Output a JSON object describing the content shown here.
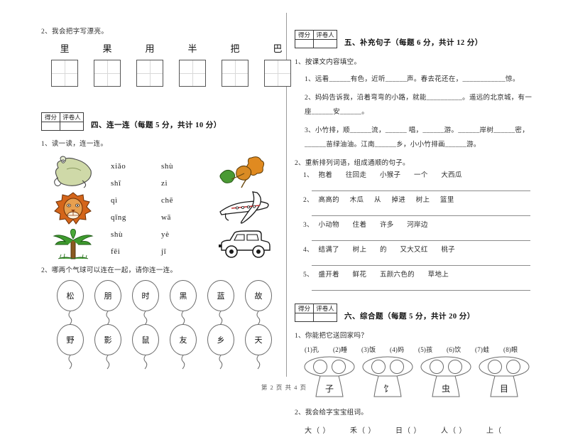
{
  "document": {
    "footer": "第 2 页 共 4 页"
  },
  "left_column": {
    "handwriting": {
      "prompt": "2、我会把字写漂亮。",
      "characters": [
        "里",
        "果",
        "用",
        "半",
        "把",
        "巴"
      ]
    },
    "section_four": {
      "score_header": {
        "score_label": "得分",
        "grader_label": "评卷人"
      },
      "title": "四、连一连（每题 5 分，共计 10 分）",
      "q1_prompt": "1、读一读，连一连。",
      "pinyin_left": [
        "xiǎo",
        "shī",
        "qì",
        "qīng",
        "shù",
        "fēi"
      ],
      "pinyin_right": [
        "shù",
        "zi",
        "chē",
        "wā",
        "yè",
        "jī"
      ],
      "pictures": [
        "frog",
        "oak-leaves",
        "lion",
        "airplane",
        "tree",
        "car"
      ],
      "q2_prompt": "2、哪两个气球可以连在一起，请你连一连。",
      "balloons_row1": [
        "松",
        "朋",
        "时",
        "黑",
        "蓝",
        "故"
      ],
      "balloons_row2": [
        "野",
        "影",
        "鼠",
        "友",
        "乡",
        "天"
      ]
    }
  },
  "right_column": {
    "section_five": {
      "score_header": {
        "score_label": "得分",
        "grader_label": "评卷人"
      },
      "title": "五、补充句子（每题 6 分，共计 12 分）",
      "q1_prompt": "1、按课文内容填空。",
      "fill_sentences": [
        "1、远看______有色，近听______声。春去花还在，____________惊。",
        "2、妈妈告诉我，沿着弯弯的小路，就能__________。遥远的北京城，有一座______安______。",
        "3、小竹排，顺______流，______ 唱，______游。______岸树______密，______苗绿油油。江南______乡，小小竹排画______游。"
      ],
      "q2_prompt": "2、重新排列词语，组成通顺的句子。",
      "reorder": [
        {
          "num": "1、",
          "words": [
            "抱着",
            "往回走",
            "小猴子",
            "一个",
            "大西瓜"
          ]
        },
        {
          "num": "2、",
          "words": [
            "高高的",
            "木瓜",
            "从",
            "掉进",
            "树上",
            "篮里"
          ]
        },
        {
          "num": "3、",
          "words": [
            "小动物",
            "住着",
            "许多",
            "河岸边"
          ]
        },
        {
          "num": "4、",
          "words": [
            "结满了",
            "树上",
            "的",
            "又大又红",
            "桃子"
          ]
        },
        {
          "num": "5、",
          "words": [
            "盛开着",
            "鲜花",
            "五颜六色的",
            "草地上"
          ]
        }
      ]
    },
    "section_six": {
      "score_header": {
        "score_label": "得分",
        "grader_label": "评卷人"
      },
      "title": "六、综合题（每题 5 分，共计 20 分）",
      "q1_prompt": "1、你能把它送回家吗？",
      "numbered_chars": [
        "(1)孔",
        "(2)睡",
        "(3)饭",
        "(4)妈",
        "(5)孩",
        "(6)饮",
        "(7)蛙",
        "(8)眼"
      ],
      "mushroom_radicals": [
        "子",
        "饣",
        "虫",
        "目"
      ],
      "q2_prompt": "2、我会给字宝宝组词。",
      "word_build": [
        "大（      ）",
        "禾（      ）",
        "日（      ）",
        "人（      ）",
        "上（"
      ]
    }
  },
  "colors": {
    "text": "#2b2b2b",
    "rule": "#555555",
    "divider": "#9a9a9a"
  }
}
